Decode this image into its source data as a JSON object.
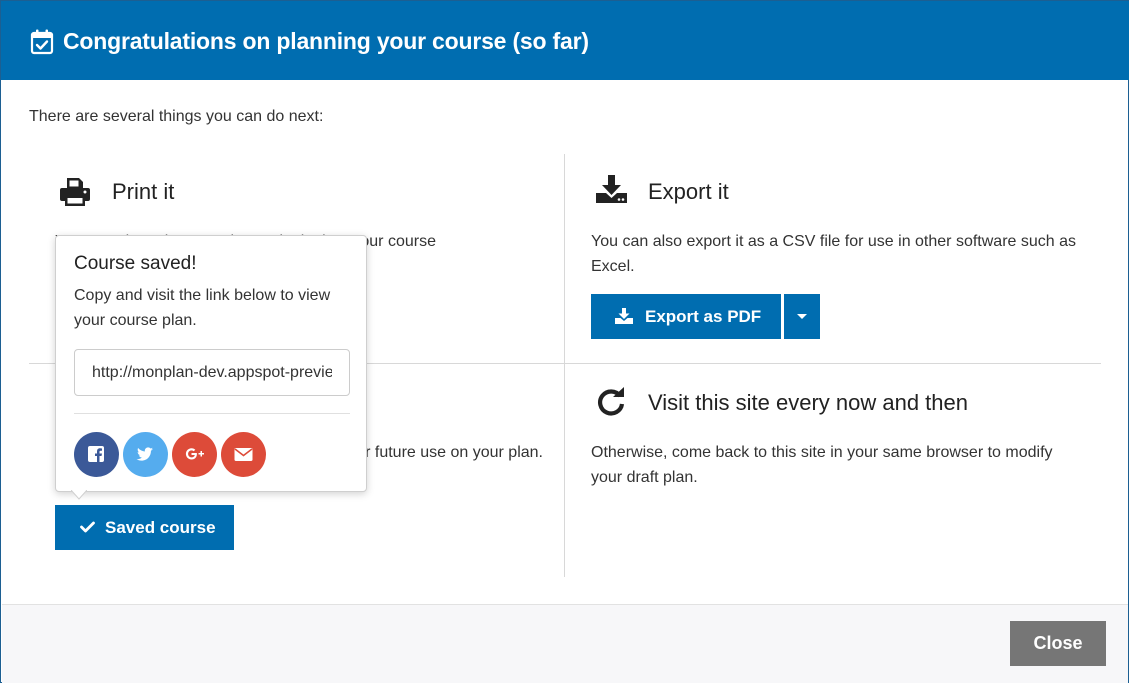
{
  "header": {
    "title": "Congratulations on planning your course (so far)",
    "icon": "calendar-check-icon"
  },
  "intro": "There are several things you can do next:",
  "print": {
    "title": "Print it",
    "icon": "printer-icon",
    "text": "You can also print your plan and take it to your course"
  },
  "export": {
    "title": "Export it",
    "icon": "download-icon",
    "text": "You can also export it as a CSV file for use in other software such as Excel.",
    "button_label": "Export as PDF",
    "dropdown_icon": "caret-down-icon"
  },
  "save": {
    "text": "Save the link for future use on your plan.",
    "button_label": "Saved course",
    "button_icon": "check-icon"
  },
  "visit": {
    "title": "Visit this site every now and then",
    "icon": "refresh-icon",
    "text": "Otherwise, come back to this site in your same browser to modify your draft plan."
  },
  "popover": {
    "title": "Course saved!",
    "text": "Copy and visit the link below to view your course plan.",
    "link_value": "http://monplan-dev.appspot-preview.com/",
    "social": [
      {
        "name": "facebook",
        "icon": "facebook-icon",
        "color": "#3b5998"
      },
      {
        "name": "twitter",
        "icon": "twitter-icon",
        "color": "#55acee"
      },
      {
        "name": "google-plus",
        "icon": "google-plus-icon",
        "color": "#dd4b39"
      },
      {
        "name": "email",
        "icon": "envelope-icon",
        "color": "#dd4b39"
      }
    ]
  },
  "footer": {
    "close_label": "Close"
  },
  "colors": {
    "primary": "#006db0",
    "close_button": "#767676"
  }
}
